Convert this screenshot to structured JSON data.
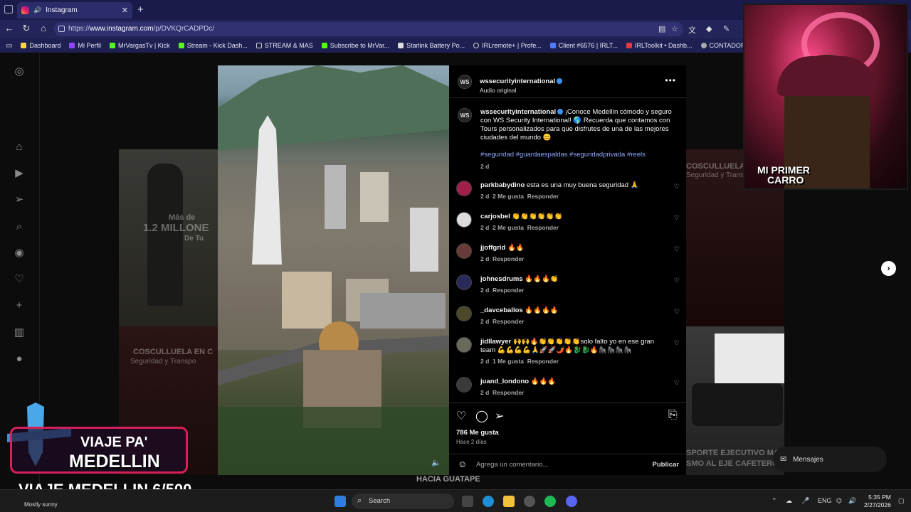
{
  "browser": {
    "tab_title": "Instagram",
    "url_prefix": "https://",
    "url_host": "www.instagram.com",
    "url_path": "/p/DVKQrCADPDc/",
    "bookmarks": [
      "Dashboard",
      "Mi Perfil",
      "MrVargasTv | Kick",
      "Stream - Kick Dash...",
      "STREAM & MAS",
      "Subscribe to MrVar...",
      "Starlink Battery Po...",
      "IRLremote+ | Profe...",
      "Client #6576 | IRLT...",
      "IRLToolkit • Dashb...",
      "CONTADOR"
    ]
  },
  "post": {
    "author": "wssecurityinternational",
    "author_avatar": "WS",
    "audio": "Audio original",
    "caption_text": "¡Conoce Medellín cómodo y seguro con WS Security International! 🌎 Recuerda que contamos con Tours personalizados para que disfrutes de una de las mejores ciudades del mundo 😊",
    "hashtags": "#seguridad #guardaespaldas #seguridadprivada #reels",
    "caption_age": "2 d",
    "likes": "786 Me gusta",
    "posted": "Hace 2 días",
    "comment_placeholder": "Agrega un comentario...",
    "publish_label": "Publicar"
  },
  "comments": [
    {
      "user": "parkbabydino",
      "text": "esta es una muy buena seguridad 🙏",
      "age": "2 d",
      "likes": "2 Me gusta",
      "reply": "Responder"
    },
    {
      "user": "carjosbel",
      "text": "👏👏👏👏👏👏",
      "age": "2 d",
      "likes": "2 Me gusta",
      "reply": "Responder"
    },
    {
      "user": "jjoffgrid",
      "text": "🔥🔥",
      "age": "2 d",
      "likes": "",
      "reply": "Responder"
    },
    {
      "user": "johnesdrums",
      "text": "🔥🔥🔥👏",
      "age": "2 d",
      "likes": "",
      "reply": "Responder"
    },
    {
      "user": "_davceballos",
      "text": "🔥🔥🔥🔥",
      "age": "2 d",
      "likes": "",
      "reply": "Responder"
    },
    {
      "user": "jidllawyer",
      "text": "🙌🙌🔥👏👏👏👏👏solo falto yo en ese gran team 💪💪💪💪🙏🚀🚀🌶️🔥🐉🐉🔥🦍🦍🦍🦍",
      "age": "2 d",
      "likes": "1 Me gusta",
      "reply": "Responder"
    },
    {
      "user": "juand_londono",
      "text": "🔥🔥🔥",
      "age": "2 d",
      "likes": "",
      "reply": "Responder"
    }
  ],
  "background_tiles": {
    "tile1_line1": "Más de",
    "tile1_line2": "1.2 MILLONE",
    "tile1_line3": "De Tu",
    "tile2_line1": "COSCULLUELA EN C",
    "tile2_line2": "Seguridad y Transpo",
    "tile3_line1": "COSCULLUELA E",
    "tile3_line2": "Seguridad y Transp",
    "tile4_line1": "SPORTE EJECUTIVO MA",
    "tile4_line2": "SMO AL EJE CAFETERO",
    "tile5": "HACIA GUATAPE"
  },
  "messages_label": "Mensajes",
  "overlay": {
    "webcam_label_1": "MI PRIMER",
    "webcam_label_2": "CARRO",
    "badge_line1": "VIAJE PA'",
    "badge_line2": "MEDELLIN",
    "ticker": "VIAJE MEDELLIN 6/500"
  },
  "taskbar": {
    "weather": "Mostly sunny",
    "search": "Search",
    "lang": "ENG",
    "time": "5:35 PM",
    "date": "2/27/2026"
  },
  "colors": {
    "accent": "#3897f0",
    "badge_border": "#d6205a",
    "kick_green": "#53fc18"
  }
}
